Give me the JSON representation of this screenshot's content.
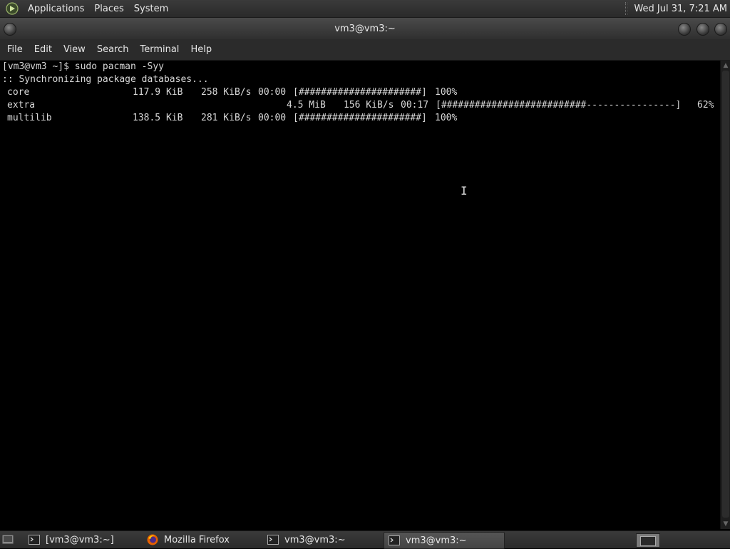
{
  "top_panel": {
    "menus": [
      "Applications",
      "Places",
      "System"
    ],
    "clock": "Wed Jul 31,  7:21 AM"
  },
  "window": {
    "title": "vm3@vm3:~"
  },
  "menubar": {
    "items": [
      "File",
      "Edit",
      "View",
      "Search",
      "Terminal",
      "Help"
    ]
  },
  "terminal": {
    "prompt_line": "[vm3@vm3 ~]$ sudo pacman -Syy",
    "sync_line": ":: Synchronizing package databases...",
    "packages": [
      {
        "name": "core",
        "size": "117.9 KiB",
        "rate": "258 KiB/s",
        "time": "00:00",
        "bar": "[######################]",
        "percent": "100%"
      },
      {
        "name": "extra",
        "size": "4.5 MiB",
        "rate": "156 KiB/s",
        "time": "00:17",
        "bar": "[##########################----------------]",
        "percent": "62%"
      },
      {
        "name": "multilib",
        "size": "138.5 KiB",
        "rate": "281 KiB/s",
        "time": "00:00",
        "bar": "[######################]",
        "percent": "100%"
      }
    ]
  },
  "taskbar": {
    "tasks": [
      {
        "label": "[vm3@vm3:~]",
        "icon": "terminal-icon",
        "active": false
      },
      {
        "label": "Mozilla Firefox",
        "icon": "firefox-icon",
        "active": false
      },
      {
        "label": "vm3@vm3:~",
        "icon": "terminal-icon",
        "active": false
      },
      {
        "label": "vm3@vm3:~",
        "icon": "terminal-icon",
        "active": true
      }
    ]
  },
  "colors": {
    "terminal_bg": "#000000",
    "terminal_fg": "#d8d8d8",
    "panel_bg": "#2f2f2f"
  }
}
